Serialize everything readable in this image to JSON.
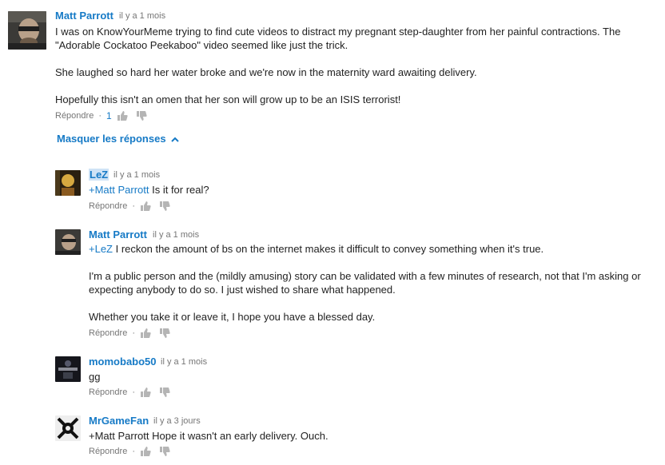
{
  "comments": [
    {
      "author": "Matt Parrott",
      "time": "il y a 1 mois",
      "lines": [
        "I was on KnowYourMeme trying to find cute videos to distract my pregnant step-daughter from her painful contractions. The",
        "\"Adorable Cockatoo Peekaboo\" video seemed like just the trick.",
        "She laughed so hard her water broke and we're now in the maternity ward awaiting delivery.",
        "Hopefully this isn't an omen that her son will grow up to be an ISIS terrorist!"
      ],
      "reply_label": "Répondre",
      "likes": "1"
    }
  ],
  "hide_replies_label": "Masquer les réponses",
  "replies": [
    {
      "author": "LeZ",
      "time": "il y a 1 mois",
      "mention": "+Matt Parrott",
      "lines": [
        " Is it for real?"
      ],
      "reply_label": "Répondre"
    },
    {
      "author": "Matt Parrott",
      "time": "il y a 1 mois",
      "mention": "+LeZ",
      "lines": [
        " I reckon the amount of bs on the internet makes it difficult to convey something when it's true.",
        "I'm a public person and the (mildly amusing) story can be validated with a few minutes of research, not that I'm asking or",
        "expecting anybody to do so. I just wished to share what happened.",
        "Whether you take it or leave it, I hope you have a blessed day."
      ],
      "reply_label": "Répondre"
    },
    {
      "author": "momobabo50",
      "time": "il y a 1 mois",
      "lines": [
        "gg"
      ],
      "reply_label": "Répondre"
    },
    {
      "author": "MrGameFan",
      "time": "il y a 3 jours",
      "lines": [
        "+Matt Parrott Hope it wasn't an early delivery.  Ouch."
      ],
      "reply_label": "Répondre"
    }
  ],
  "colors": {
    "link": "#167ac6",
    "meta": "#767676",
    "text": "#222222",
    "highlight": "#cfe3f6"
  },
  "icons": {
    "like": "thumbs-up-icon",
    "dislike": "thumbs-down-icon",
    "hide": "chevron-up-icon"
  }
}
